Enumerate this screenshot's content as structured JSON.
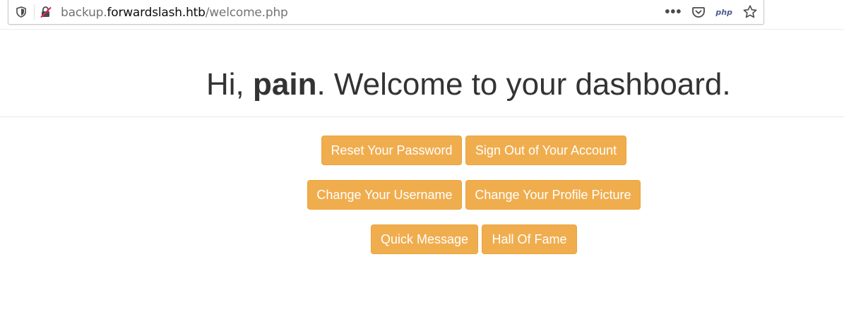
{
  "browser": {
    "url_prefix": "backup.",
    "url_host": "forwardslash.htb",
    "url_path": "/welcome.php",
    "php_badge": "php"
  },
  "page": {
    "greeting": "Hi, ",
    "username": "pain",
    "greeting_rest": ". Welcome to your dashboard."
  },
  "buttons": {
    "reset_password": "Reset Your Password",
    "sign_out": "Sign Out of Your Account",
    "change_username": "Change Your Username",
    "change_picture": "Change Your Profile Picture",
    "quick_message": "Quick Message",
    "hall_of_fame": "Hall Of Fame"
  },
  "colors": {
    "button_bg": "#f0ad4e",
    "button_border": "#eea236",
    "heading_text": "#333333"
  }
}
